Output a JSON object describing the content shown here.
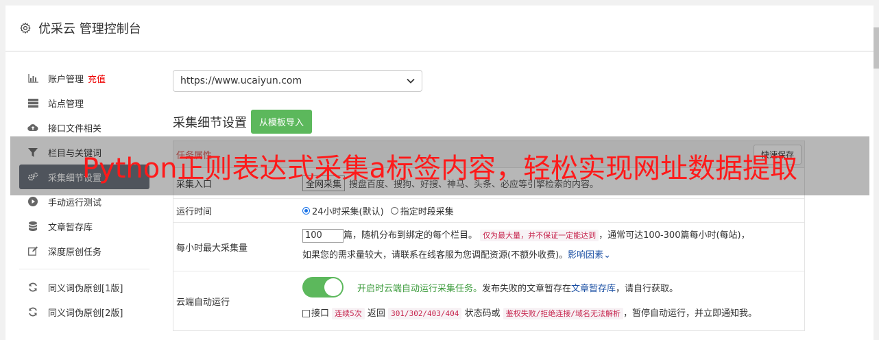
{
  "header": {
    "title": "优采云 管理控制台",
    "icon": "gear-icon"
  },
  "sidebar": {
    "items": [
      {
        "label": "账户管理",
        "icon": "bar-chart-icon",
        "badge": "充值"
      },
      {
        "label": "站点管理",
        "icon": "server-icon"
      },
      {
        "label": "接口文件相关",
        "icon": "cloud-upload-icon"
      },
      {
        "label": "栏目与关键词",
        "icon": "filter-icon"
      },
      {
        "label": "采集细节设置",
        "icon": "gears-icon",
        "active": true
      },
      {
        "label": "手动运行测试",
        "icon": "play-icon"
      },
      {
        "label": "文章暂存库",
        "icon": "database-icon"
      },
      {
        "label": "深度原创任务",
        "icon": "edit-icon"
      },
      {
        "label": "同义词伪原创[1版]",
        "icon": "refresh-icon"
      },
      {
        "label": "同义词伪原创[2版]",
        "icon": "refresh-icon"
      }
    ]
  },
  "site_select": {
    "value": "https://www.ucaiyun.com"
  },
  "section": {
    "title": "采集细节设置",
    "import_button": "从模板导入"
  },
  "panel": {
    "head_left": "任务属性",
    "quick_save": "快速保存",
    "rows": {
      "source": {
        "label": "采集入口",
        "value": "全网采集",
        "desc": "搜盘百度、搜狗、好搜、神马、头条、必应等引擎检索的内容。"
      },
      "runtime": {
        "label": "运行时间",
        "opt1": "24小时采集(默认)",
        "opt2": "指定时段采集"
      },
      "max": {
        "label": "每小时最大采集量",
        "value": "100",
        "t1": "篇，随机分布到绑定的每个栏目。",
        "code1": "仅为最大量，并不保证一定能达到",
        "t2": "，通常可达100-300篇每小时(每站)，",
        "t3": "如果您的需求量较大，请联系在线客服为您调配资源(不额外收费)。",
        "link": "影响因素"
      },
      "auto": {
        "label": "云端自动运行",
        "green": "开启时云端自动运行采集任务。",
        "t1": "发布失败的文章暂存在",
        "link": "文章暂存库",
        "t2": "，请自行获取。",
        "c_label": "接口",
        "code1": "连续5次",
        "t3": "返回",
        "code2": "301/302/403/404",
        "t4": "状态码或",
        "code3": "鉴权失败/拒绝连接/域名无法解析",
        "t5": "，暂停自动运行，并立即通知我。"
      }
    }
  },
  "overlay": {
    "text": "Python正则表达式采集a标签内容，轻松实现网址数据提取"
  },
  "colors": {
    "green": "#5cb85c",
    "active_nav": "#666e7a",
    "overlay_text": "#ff1a1a"
  }
}
